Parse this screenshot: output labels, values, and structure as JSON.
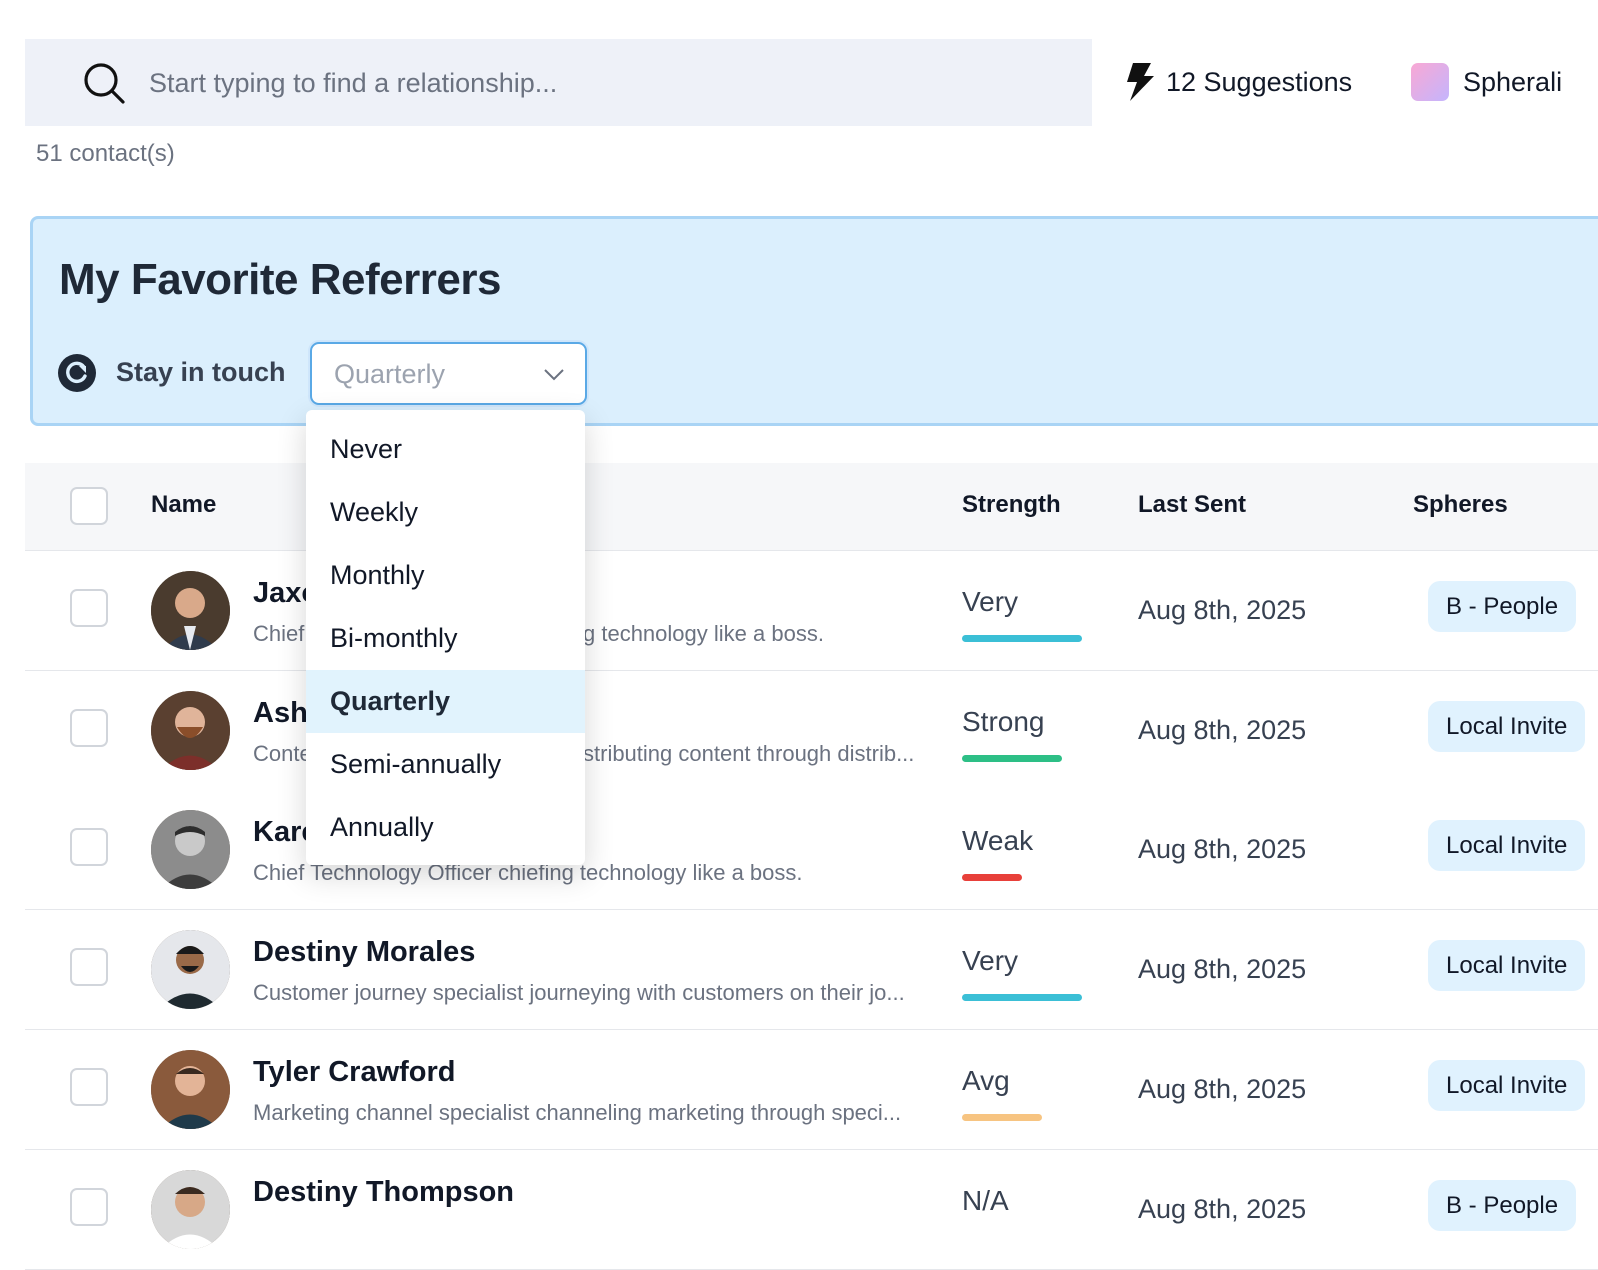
{
  "search": {
    "placeholder": "Start typing to find a relationship..."
  },
  "suggestions": {
    "label": "12 Suggestions"
  },
  "spheres_menu": {
    "label": "Spherali"
  },
  "contact_count": "51 contact(s)",
  "group": {
    "title": "My Favorite Referrers",
    "stay_in_touch_label": "Stay in touch",
    "frequency_value": "Quarterly",
    "frequency_options": [
      "Never",
      "Weekly",
      "Monthly",
      "Bi-monthly",
      "Quarterly",
      "Semi-annually",
      "Annually"
    ],
    "selected_option": "Quarterly"
  },
  "table": {
    "headers": {
      "name": "Name",
      "strength": "Strength",
      "last_sent": "Last Sent",
      "spheres": "Spheres"
    },
    "rows": [
      {
        "name": "Jaxo",
        "title_left": "Chief",
        "title_right": "g technology like a boss.",
        "strength": "Very",
        "strength_level": 1.0,
        "strength_color": "#3bbfd6",
        "last_sent": "Aug 8th, 2025",
        "sphere": "B - People"
      },
      {
        "name": "Ash",
        "title_left": "Conte",
        "title_right": "stributing content through distrib...",
        "strength": "Strong",
        "strength_level": 0.83,
        "strength_color": "#2dbf86",
        "last_sent": "Aug 8th, 2025",
        "sphere": "Local Invite"
      },
      {
        "name": "Kare",
        "title": "Chief Technology Officer chiefing technology like a boss.",
        "strength": "Weak",
        "strength_level": 0.5,
        "strength_color": "#e8403a",
        "last_sent": "Aug 8th, 2025",
        "sphere": "Local Invite"
      },
      {
        "name": "Destiny Morales",
        "title": "Customer journey specialist journeying with customers on their jo...",
        "strength": "Very",
        "strength_level": 1.0,
        "strength_color": "#3bbfd6",
        "last_sent": "Aug 8th, 2025",
        "sphere": "Local Invite"
      },
      {
        "name": "Tyler Crawford",
        "title": "Marketing channel specialist channeling marketing through speci...",
        "strength": "Avg",
        "strength_level": 0.67,
        "strength_color": "#f7c481",
        "last_sent": "Aug 8th, 2025",
        "sphere": "Local Invite"
      },
      {
        "name": "Destiny Thompson",
        "title": "",
        "strength": "N/A",
        "strength_level": 0,
        "strength_color": "#d1d5db",
        "last_sent": "Aug 8th, 2025",
        "sphere": "B - People"
      }
    ]
  },
  "icons": {
    "search": "search-icon",
    "bolt": "lightning-bolt-icon",
    "refresh": "refresh-icon",
    "chevron": "chevron-down-icon"
  }
}
